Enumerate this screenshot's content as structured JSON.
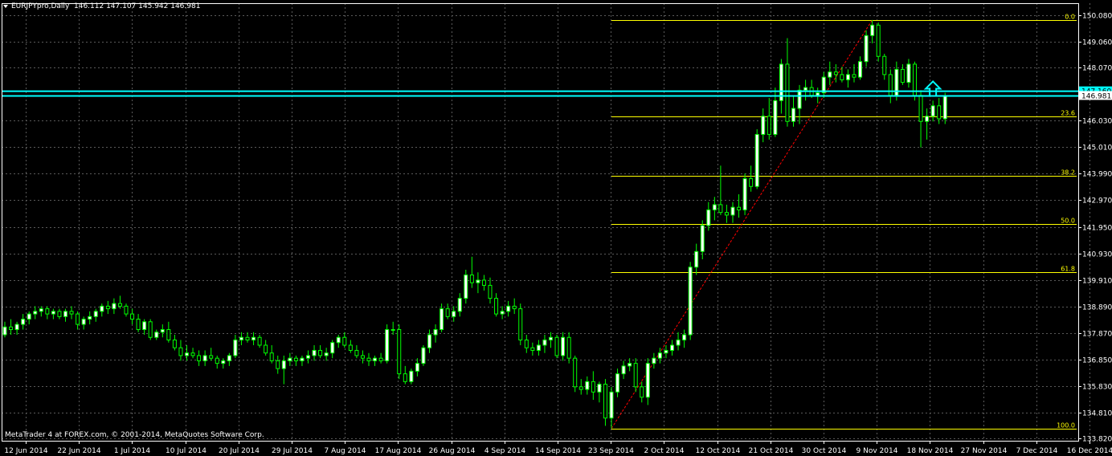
{
  "header": {
    "symbol": "EURJPYpro,Daily",
    "ohlc": "146.112 147.107 145.942 146.981"
  },
  "footer": {
    "copyright": "MetaTrader 4 at FOREX.com, © 2001-2014, MetaQuotes Software Corp."
  },
  "colors": {
    "background": "#000000",
    "grid": "#5a5a5a",
    "candle": "#00ff00",
    "bull_body": "#ffffff",
    "bear_body": "#000000",
    "fib_line": "#ffff00",
    "price_line": "#00ffff",
    "trend_line": "#ff0000",
    "axis_text": "#ffffff"
  },
  "chart_data": {
    "type": "candlestick",
    "title": "EURJPYpro,Daily",
    "x_axis_labels": [
      "12 Jun 2014",
      "22 Jun 2014",
      "1 Jul 2014",
      "10 Jul 2014",
      "20 Jul 2014",
      "29 Jul 2014",
      "7 Aug 2014",
      "17 Aug 2014",
      "26 Aug 2014",
      "4 Sep 2014",
      "14 Sep 2014",
      "23 Sep 2014",
      "2 Oct 2014",
      "12 Oct 2014",
      "21 Oct 2014",
      "30 Oct 2014",
      "9 Nov 2014",
      "18 Nov 2014",
      "27 Nov 2014",
      "7 Dec 2014",
      "16 Dec 2014"
    ],
    "y_axis_labels": [
      "150.080",
      "149.060",
      "148.070",
      "146.030",
      "145.010",
      "143.990",
      "142.970",
      "141.950",
      "140.930",
      "139.910",
      "138.890",
      "137.870",
      "136.850",
      "135.830",
      "134.810",
      "133.820"
    ],
    "ylim": [
      133.82,
      150.08
    ],
    "grid": true,
    "current_price_labels": [
      "147.160",
      "146.981"
    ],
    "price_lines": [
      147.16,
      146.981
    ],
    "fibonacci": {
      "high": 149.9,
      "low": 134.2,
      "levels": [
        {
          "label": "0.0",
          "price": 149.9
        },
        {
          "label": "23.6",
          "price": 146.19
        },
        {
          "label": "38.2",
          "price": 143.9
        },
        {
          "label": "50.0",
          "price": 142.05
        },
        {
          "label": "61.8",
          "price": 140.2
        },
        {
          "label": "100.0",
          "price": 134.2
        }
      ]
    },
    "trend_line": {
      "from_price": 134.2,
      "to_price": 149.9
    },
    "arrow_marker": {
      "price": 146.98,
      "direction": "up"
    },
    "candles": [
      [
        137.8,
        138.3,
        137.7,
        138.1
      ],
      [
        138.1,
        138.4,
        137.8,
        138.0
      ],
      [
        138.0,
        138.3,
        137.8,
        138.2
      ],
      [
        138.2,
        138.6,
        138.0,
        138.4
      ],
      [
        138.4,
        138.7,
        138.2,
        138.6
      ],
      [
        138.6,
        138.9,
        138.4,
        138.7
      ],
      [
        138.7,
        138.9,
        138.5,
        138.8
      ],
      [
        138.8,
        138.9,
        138.4,
        138.6
      ],
      [
        138.6,
        138.8,
        138.4,
        138.7
      ],
      [
        138.7,
        138.8,
        138.4,
        138.5
      ],
      [
        138.5,
        138.8,
        138.3,
        138.7
      ],
      [
        138.7,
        138.9,
        138.4,
        138.6
      ],
      [
        138.6,
        138.7,
        138.0,
        138.2
      ],
      [
        138.2,
        138.5,
        138.0,
        138.4
      ],
      [
        138.4,
        138.7,
        138.2,
        138.5
      ],
      [
        138.5,
        138.8,
        138.3,
        138.7
      ],
      [
        138.7,
        139.0,
        138.5,
        138.9
      ],
      [
        138.9,
        139.1,
        138.6,
        138.8
      ],
      [
        138.8,
        139.2,
        138.6,
        139.0
      ],
      [
        139.0,
        139.3,
        138.8,
        138.9
      ],
      [
        138.9,
        139.0,
        138.5,
        138.6
      ],
      [
        138.6,
        138.8,
        138.2,
        138.4
      ],
      [
        138.4,
        138.6,
        137.9,
        138.0
      ],
      [
        138.0,
        138.4,
        137.8,
        138.3
      ],
      [
        138.3,
        138.4,
        137.6,
        137.7
      ],
      [
        137.7,
        138.0,
        137.6,
        137.9
      ],
      [
        137.9,
        138.2,
        137.7,
        138.0
      ],
      [
        138.0,
        138.3,
        137.5,
        137.6
      ],
      [
        137.6,
        137.8,
        137.2,
        137.3
      ],
      [
        137.3,
        137.6,
        136.8,
        137.0
      ],
      [
        137.0,
        137.4,
        136.8,
        137.1
      ],
      [
        137.1,
        137.3,
        136.9,
        137.0
      ],
      [
        137.0,
        137.2,
        136.6,
        136.8
      ],
      [
        136.8,
        137.2,
        136.6,
        137.0
      ],
      [
        137.0,
        137.3,
        136.8,
        136.9
      ],
      [
        136.9,
        137.0,
        136.5,
        136.7
      ],
      [
        136.7,
        136.9,
        136.5,
        136.8
      ],
      [
        136.8,
        137.1,
        136.6,
        137.0
      ],
      [
        137.0,
        137.8,
        136.9,
        137.6
      ],
      [
        137.6,
        137.9,
        137.4,
        137.7
      ],
      [
        137.7,
        137.9,
        137.5,
        137.6
      ],
      [
        137.6,
        137.9,
        137.4,
        137.7
      ],
      [
        137.7,
        137.8,
        137.3,
        137.4
      ],
      [
        137.4,
        137.6,
        137.0,
        137.1
      ],
      [
        137.1,
        137.4,
        136.7,
        136.8
      ],
      [
        136.8,
        137.0,
        136.3,
        136.5
      ],
      [
        136.5,
        137.0,
        135.9,
        136.8
      ],
      [
        136.8,
        137.1,
        136.6,
        136.9
      ],
      [
        136.9,
        137.0,
        136.6,
        136.8
      ],
      [
        136.8,
        137.0,
        136.6,
        136.9
      ],
      [
        136.9,
        137.2,
        136.7,
        137.0
      ],
      [
        137.0,
        137.4,
        136.8,
        137.2
      ],
      [
        137.2,
        137.4,
        136.9,
        137.0
      ],
      [
        137.0,
        137.3,
        136.8,
        137.1
      ],
      [
        137.1,
        137.6,
        136.9,
        137.5
      ],
      [
        137.5,
        137.8,
        137.3,
        137.7
      ],
      [
        137.7,
        137.9,
        137.3,
        137.4
      ],
      [
        137.4,
        137.6,
        137.1,
        137.2
      ],
      [
        137.2,
        137.4,
        136.9,
        137.0
      ],
      [
        137.0,
        137.2,
        136.7,
        136.9
      ],
      [
        136.9,
        137.1,
        136.6,
        136.8
      ],
      [
        136.8,
        137.0,
        136.6,
        136.9
      ],
      [
        136.9,
        137.1,
        136.7,
        136.8
      ],
      [
        136.8,
        138.2,
        136.7,
        138.0
      ],
      [
        138.0,
        138.3,
        137.8,
        138.0
      ],
      [
        138.0,
        138.2,
        136.1,
        136.3
      ],
      [
        136.3,
        136.6,
        135.9,
        136.0
      ],
      [
        136.0,
        136.5,
        135.9,
        136.4
      ],
      [
        136.4,
        136.9,
        136.2,
        136.7
      ],
      [
        136.7,
        137.4,
        136.6,
        137.3
      ],
      [
        137.3,
        138.0,
        137.1,
        137.8
      ],
      [
        137.8,
        138.2,
        137.5,
        138.0
      ],
      [
        138.0,
        139.0,
        137.9,
        138.8
      ],
      [
        138.8,
        139.0,
        138.4,
        138.5
      ],
      [
        138.5,
        138.9,
        138.3,
        138.7
      ],
      [
        138.7,
        139.4,
        138.5,
        139.2
      ],
      [
        139.2,
        140.3,
        139.0,
        140.1
      ],
      [
        140.1,
        140.8,
        139.6,
        139.8
      ],
      [
        139.8,
        140.2,
        139.4,
        139.9
      ],
      [
        139.9,
        140.1,
        139.5,
        139.7
      ],
      [
        139.7,
        140.0,
        139.0,
        139.2
      ],
      [
        139.2,
        139.4,
        138.5,
        138.6
      ],
      [
        138.6,
        138.9,
        138.4,
        138.7
      ],
      [
        138.7,
        139.1,
        138.5,
        138.9
      ],
      [
        138.9,
        139.2,
        138.6,
        138.8
      ],
      [
        138.8,
        139.0,
        137.4,
        137.6
      ],
      [
        137.6,
        137.8,
        137.1,
        137.3
      ],
      [
        137.3,
        137.5,
        137.0,
        137.2
      ],
      [
        137.2,
        137.6,
        137.0,
        137.4
      ],
      [
        137.4,
        137.8,
        137.1,
        137.6
      ],
      [
        137.6,
        137.9,
        137.3,
        137.7
      ],
      [
        137.7,
        137.8,
        136.9,
        137.0
      ],
      [
        137.0,
        137.9,
        136.8,
        137.7
      ],
      [
        137.7,
        137.9,
        136.7,
        136.9
      ],
      [
        136.9,
        137.0,
        135.6,
        135.8
      ],
      [
        135.8,
        136.1,
        135.5,
        135.7
      ],
      [
        135.7,
        136.2,
        135.5,
        136.0
      ],
      [
        136.0,
        136.4,
        135.3,
        135.6
      ],
      [
        135.6,
        136.0,
        135.2,
        135.9
      ],
      [
        135.9,
        136.1,
        134.3,
        134.6
      ],
      [
        134.6,
        135.8,
        134.2,
        135.6
      ],
      [
        135.6,
        136.5,
        135.4,
        136.3
      ],
      [
        136.3,
        136.8,
        136.1,
        136.6
      ],
      [
        136.6,
        136.9,
        136.4,
        136.7
      ],
      [
        136.7,
        136.9,
        135.6,
        135.8
      ],
      [
        135.8,
        136.0,
        135.2,
        135.4
      ],
      [
        135.4,
        136.9,
        135.1,
        136.7
      ],
      [
        136.7,
        137.1,
        136.5,
        136.9
      ],
      [
        136.9,
        137.3,
        136.7,
        137.1
      ],
      [
        137.1,
        137.4,
        136.9,
        137.2
      ],
      [
        137.2,
        137.6,
        137.0,
        137.4
      ],
      [
        137.4,
        137.9,
        137.2,
        137.6
      ],
      [
        137.6,
        138.0,
        137.3,
        137.8
      ],
      [
        137.8,
        140.6,
        137.6,
        140.4
      ],
      [
        140.4,
        141.3,
        140.1,
        141.0
      ],
      [
        141.0,
        142.2,
        140.7,
        142.0
      ],
      [
        142.0,
        142.9,
        141.8,
        142.6
      ],
      [
        142.6,
        143.1,
        142.2,
        142.8
      ],
      [
        142.8,
        144.3,
        142.4,
        142.5
      ],
      [
        142.5,
        142.8,
        142.1,
        142.4
      ],
      [
        142.4,
        142.9,
        142.1,
        142.7
      ],
      [
        142.7,
        143.2,
        142.3,
        142.6
      ],
      [
        142.6,
        144.0,
        142.4,
        143.8
      ],
      [
        143.8,
        144.3,
        143.3,
        143.5
      ],
      [
        143.5,
        145.7,
        143.4,
        145.5
      ],
      [
        145.5,
        146.5,
        145.2,
        146.2
      ],
      [
        146.2,
        146.9,
        145.3,
        145.5
      ],
      [
        145.5,
        147.3,
        145.4,
        146.8
      ],
      [
        146.8,
        148.4,
        146.3,
        148.2
      ],
      [
        148.2,
        149.2,
        145.8,
        146.0
      ],
      [
        146.0,
        147.0,
        145.8,
        146.5
      ],
      [
        146.5,
        147.4,
        145.9,
        147.2
      ],
      [
        147.2,
        147.6,
        146.8,
        147.3
      ],
      [
        147.3,
        147.6,
        146.9,
        147.0
      ],
      [
        147.0,
        147.3,
        146.7,
        147.1
      ],
      [
        147.1,
        147.9,
        146.9,
        147.7
      ],
      [
        147.7,
        148.3,
        147.4,
        147.9
      ],
      [
        147.9,
        148.2,
        147.5,
        147.8
      ],
      [
        147.8,
        148.1,
        147.5,
        147.6
      ],
      [
        147.6,
        148.0,
        147.3,
        147.8
      ],
      [
        147.8,
        148.2,
        147.5,
        147.7
      ],
      [
        147.7,
        148.5,
        147.6,
        148.3
      ],
      [
        148.3,
        149.5,
        148.1,
        149.3
      ],
      [
        149.3,
        149.9,
        149.0,
        149.7
      ],
      [
        149.7,
        149.8,
        148.3,
        148.5
      ],
      [
        148.5,
        148.6,
        147.6,
        147.8
      ],
      [
        147.8,
        148.0,
        146.7,
        147.0
      ],
      [
        147.0,
        148.3,
        146.8,
        148.0
      ],
      [
        148.0,
        148.2,
        147.4,
        147.5
      ],
      [
        147.5,
        148.4,
        147.3,
        148.2
      ],
      [
        148.2,
        148.3,
        146.8,
        147.0
      ],
      [
        147.0,
        147.2,
        145.0,
        146.0
      ],
      [
        146.0,
        146.5,
        145.3,
        146.2
      ],
      [
        146.2,
        146.8,
        146.0,
        146.6
      ],
      [
        146.6,
        146.9,
        145.9,
        146.1
      ],
      [
        146.1,
        147.1,
        145.9,
        146.98
      ]
    ]
  }
}
